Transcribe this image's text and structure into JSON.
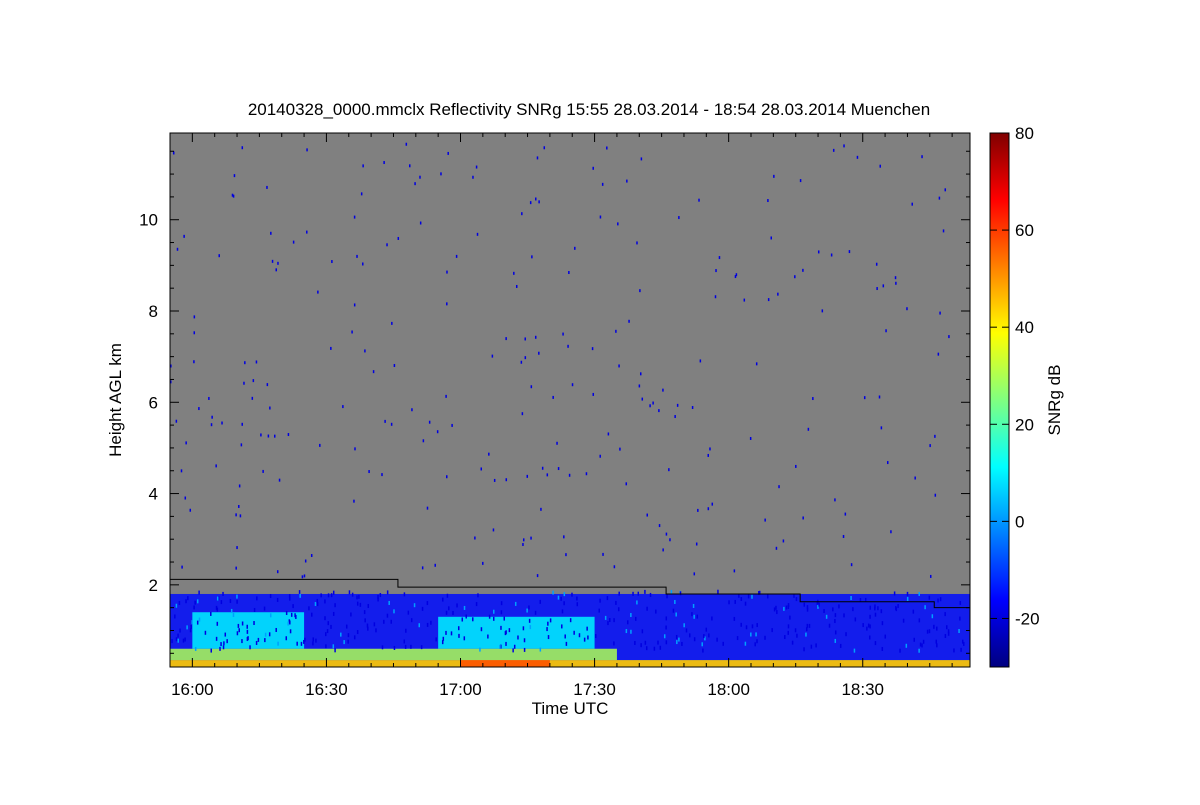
{
  "chart_data": {
    "type": "heatmap",
    "title": "20140328_0000.mmclx Reflectivity SNRg   15:55 28.03.2014 - 18:54 28.03.2014 Muenchen",
    "xlabel": "Time UTC",
    "ylabel": "Height AGL km",
    "colorbar_label": "SNRg dB",
    "xlim": [
      "15:55",
      "18:54"
    ],
    "ylim": [
      0.2,
      11.9
    ],
    "x_ticks": [
      "16:00",
      "16:30",
      "17:00",
      "17:30",
      "18:00",
      "18:30"
    ],
    "y_ticks": [
      2,
      4,
      6,
      8,
      10
    ],
    "colorbar_range": [
      -30,
      80
    ],
    "colorbar_ticks": [
      -20,
      0,
      20,
      40,
      60,
      80
    ],
    "no_signal_color": "#808080",
    "colormap": [
      "#000080",
      "#0000ff",
      "#0080ff",
      "#00ffff",
      "#80ff80",
      "#ffff00",
      "#ff8000",
      "#ff0000",
      "#800000"
    ],
    "boundary_line": {
      "name": "",
      "color": "#000000",
      "points": [
        {
          "time": "15:55",
          "height": 2.12
        },
        {
          "time": "16:46",
          "height": 2.12
        },
        {
          "time": "16:46",
          "height": 1.95
        },
        {
          "time": "17:46",
          "height": 1.95
        },
        {
          "time": "17:46",
          "height": 1.8
        },
        {
          "time": "18:16",
          "height": 1.8
        },
        {
          "time": "18:16",
          "height": 1.63
        },
        {
          "time": "18:46",
          "height": 1.63
        },
        {
          "time": "18:46",
          "height": 1.5
        },
        {
          "time": "18:54",
          "height": 1.5
        }
      ]
    },
    "echo_layers": [
      {
        "time_start": "15:55",
        "time_end": "18:54",
        "height_bottom": 0.2,
        "height_top": 0.35,
        "snr_db": 45
      },
      {
        "time_start": "15:55",
        "time_end": "17:35",
        "height_bottom": 0.35,
        "height_top": 0.6,
        "snr_db": 30
      },
      {
        "time_start": "16:00",
        "time_end": "16:25",
        "height_bottom": 0.6,
        "height_top": 1.4,
        "snr_db": 10
      },
      {
        "time_start": "16:55",
        "time_end": "17:30",
        "height_bottom": 0.6,
        "height_top": 1.3,
        "snr_db": 10
      },
      {
        "time_start": "17:00",
        "time_end": "17:20",
        "height_bottom": 0.2,
        "height_top": 0.35,
        "snr_db": 58
      },
      {
        "time_start": "15:55",
        "time_end": "18:54",
        "height_bottom": 0.35,
        "height_top": 1.8,
        "snr_db": -15
      }
    ]
  }
}
